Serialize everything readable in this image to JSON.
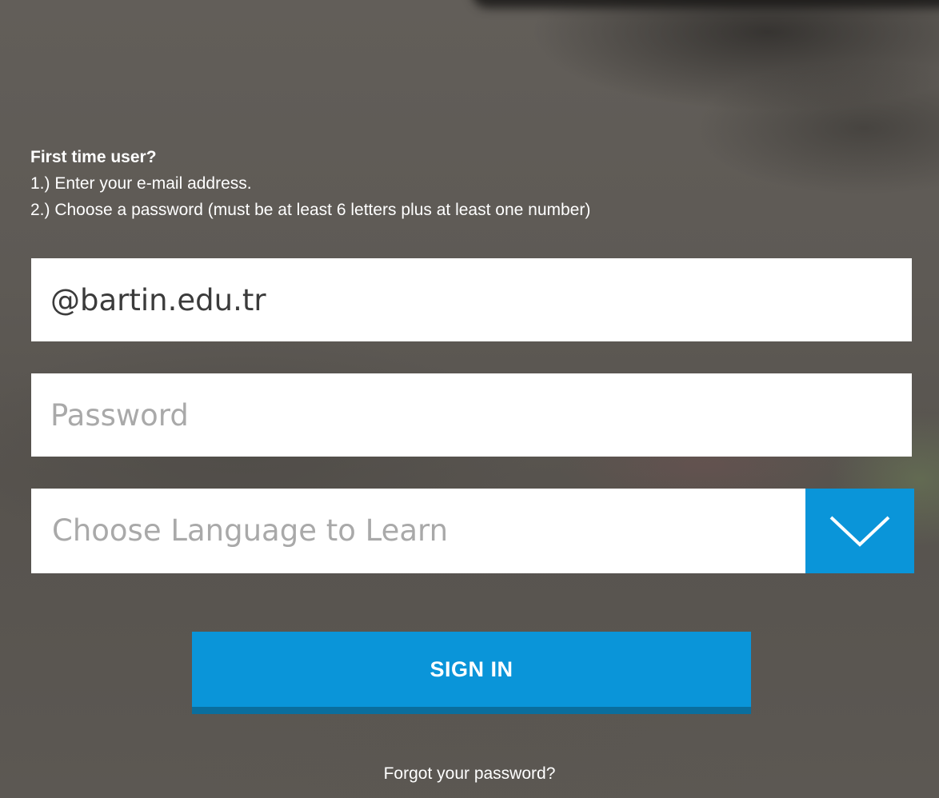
{
  "intro": {
    "heading": "First time user?",
    "step1": "1.) Enter your e-mail address.",
    "step2": "2.) Choose a password (must be at least 6 letters plus at least one number)"
  },
  "form": {
    "email_value": "@bartin.edu.tr",
    "password_placeholder": "Password",
    "language_placeholder": "Choose Language to Learn",
    "signin_label": "SIGN IN",
    "forgot_label": "Forgot your password?"
  },
  "colors": {
    "accent": "#0a95d9",
    "accent_dark": "#0a6e9e",
    "backdrop": "#5f5b56"
  },
  "icons": {
    "language_dropdown": "chevron-down-icon"
  }
}
